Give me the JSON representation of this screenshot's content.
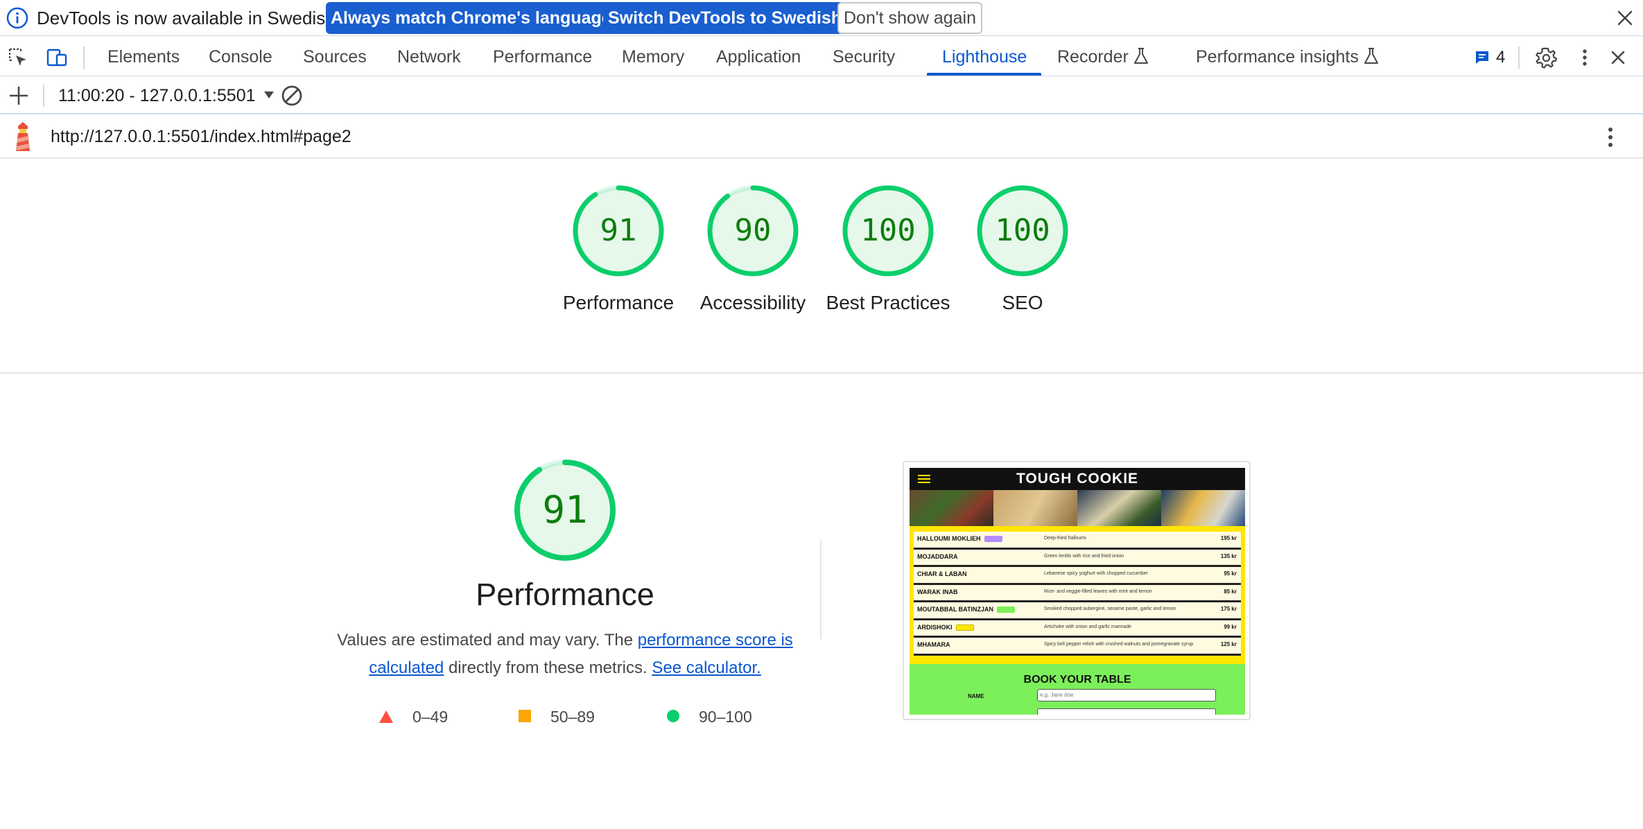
{
  "infobar": {
    "message": "DevTools is now available in Swedish!",
    "btn_match": "Always match Chrome's language",
    "btn_switch": "Switch DevTools to Swedish",
    "btn_dismiss": "Don't show again"
  },
  "tabs": {
    "elements": "Elements",
    "console": "Console",
    "sources": "Sources",
    "network": "Network",
    "performance": "Performance",
    "memory": "Memory",
    "application": "Application",
    "security": "Security",
    "lighthouse": "Lighthouse",
    "recorder": "Recorder",
    "performance_insights": "Performance insights",
    "issues_count": "4",
    "active": "Lighthouse"
  },
  "report_toolbar": {
    "report_selector": "11:00:20 - 127.0.0.1:5501"
  },
  "url_bar": {
    "url": "http://127.0.0.1:5501/index.html#page2"
  },
  "scores": [
    {
      "label": "Performance",
      "score": "91",
      "value": 91
    },
    {
      "label": "Accessibility",
      "score": "90",
      "value": 90
    },
    {
      "label": "Best Practices",
      "score": "100",
      "value": 100
    },
    {
      "label": "SEO",
      "score": "100",
      "value": 100
    }
  ],
  "performance_section": {
    "score": "91",
    "value": 91,
    "title": "Performance",
    "desc_before": "Values are estimated and may vary. The ",
    "desc_link1": "performance score is calculated",
    "desc_middle": " directly from these metrics. ",
    "desc_link2": "See calculator.",
    "legend": {
      "fail": "0–49",
      "average": "50–89",
      "pass": "90–100"
    }
  },
  "screenshot": {
    "site_title": "TOUGH COOKIE",
    "menu": [
      {
        "name": "HALLOUMI MOKLIEH",
        "desc": "Deep-fried halloumi",
        "price": "195 kr"
      },
      {
        "name": "MOJADDARA",
        "desc": "Green lentils with rice and fried onion",
        "price": "135 kr"
      },
      {
        "name": "CHIAR & LABAN",
        "desc": "Lebanese spicy yoghurt with chopped cucumber",
        "price": "95 kr"
      },
      {
        "name": "WARAK INAB",
        "desc": "Rice- and veggie-filled leaves with mint and lemon",
        "price": "85 kr"
      },
      {
        "name": "MOUTABBAL BATINZJAN",
        "desc": "Smoked chopped aubergine, sesame paste, garlic and lemon",
        "price": "175 kr"
      },
      {
        "name": "ARDISHOKI",
        "desc": "Artichoke with onion and garlic marinade",
        "price": "99 kr"
      },
      {
        "name": "MHAMARA",
        "desc": "Spicy bell pepper relish with crushed walnuts and pomegranate syrup",
        "price": "125 kr"
      }
    ],
    "book_title": "BOOK YOUR TABLE",
    "name_label": "NAME",
    "name_placeholder": "e.g. Jane doe"
  },
  "colors": {
    "accent": "#0b57d0",
    "pass": "#0cce6b",
    "pass_text": "#0c7d0c",
    "fail": "#ff4e42",
    "average": "#ffa400"
  }
}
